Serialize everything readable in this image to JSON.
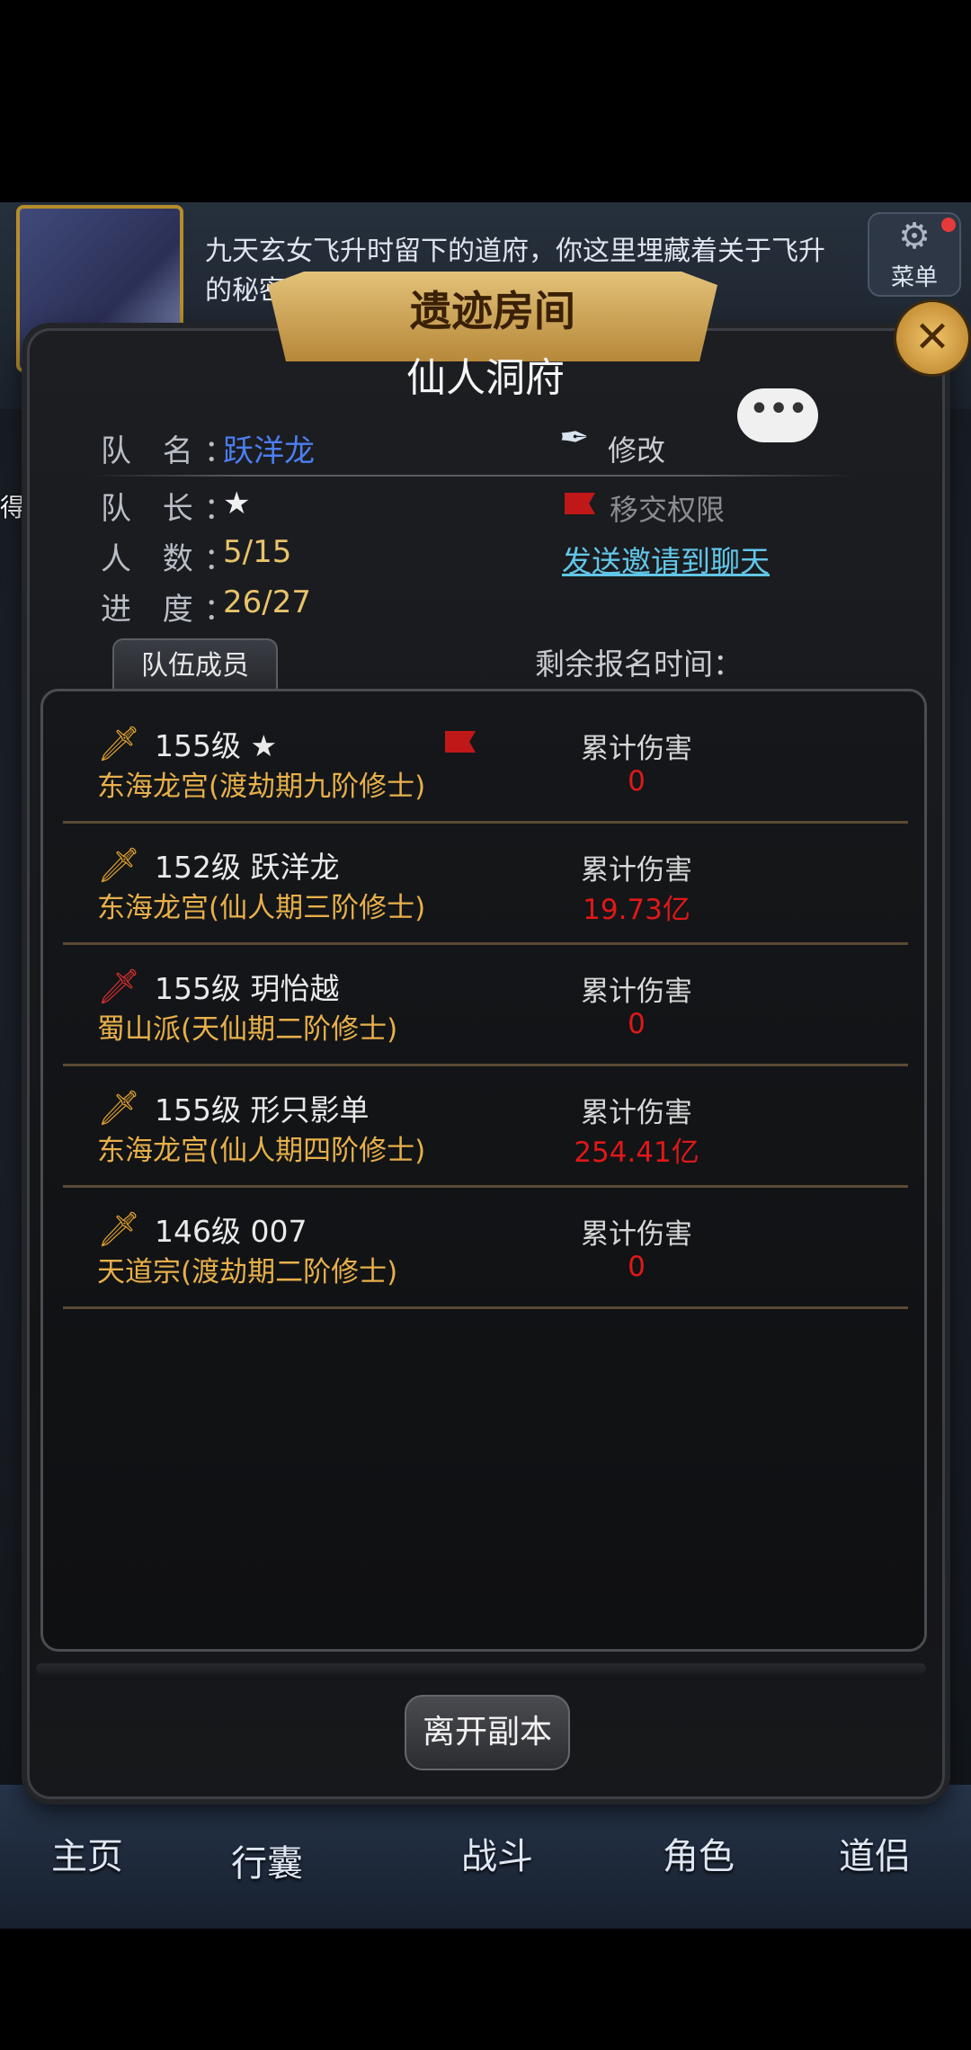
{
  "background": {
    "story_text": "九天玄女飞升时留下的道府，你这里埋藏着关于飞升的秘密",
    "menu_label": "菜单",
    "reward_text": "得了奖励"
  },
  "nav": {
    "items": [
      "主页",
      "行囊",
      "战斗",
      "角色",
      "道侣"
    ]
  },
  "dialog": {
    "title": "遗迹房间",
    "subtitle": "仙人洞府",
    "team_name_label": "队 名：",
    "team_name": "跃洋龙",
    "edit_label": "修改",
    "leader_label": "队 长：",
    "leader": "★",
    "transfer_label": "移交权限",
    "count_label": "人 数：",
    "count": "5/15",
    "invite_label": "发送邀请到聊天",
    "progress_label": "进 度：",
    "progress": "26/27",
    "tab_members": "队伍成员",
    "remaining_label": "剩余报名时间：",
    "leave_button": "离开副本"
  },
  "members": [
    {
      "level_name": "155级 ★",
      "sect": "东海龙宫(渡劫期九阶修士)",
      "dmg_label": "累计伤害",
      "dmg": "0",
      "weapon_color": "#e0a030",
      "leader": true
    },
    {
      "level_name": "152级 跃洋龙",
      "sect": "东海龙宫(仙人期三阶修士)",
      "dmg_label": "累计伤害",
      "dmg": "19.73亿",
      "weapon_color": "#e0a030",
      "leader": false
    },
    {
      "level_name": "155级 玥怡越",
      "sect": "蜀山派(天仙期二阶修士)",
      "dmg_label": "累计伤害",
      "dmg": "0",
      "weapon_color": "#d83030",
      "leader": false
    },
    {
      "level_name": "155级 形只影单",
      "sect": "东海龙宫(仙人期四阶修士)",
      "dmg_label": "累计伤害",
      "dmg": "254.41亿",
      "weapon_color": "#e0a030",
      "leader": false
    },
    {
      "level_name": "146级 007",
      "sect": "天道宗(渡劫期二阶修士)",
      "dmg_label": "累计伤害",
      "dmg": "0",
      "weapon_color": "#e0a030",
      "leader": false
    }
  ],
  "colors": {
    "accent_gold": "#e8c36a",
    "damage_red": "#e01818",
    "link_cyan": "#62c6e8"
  }
}
